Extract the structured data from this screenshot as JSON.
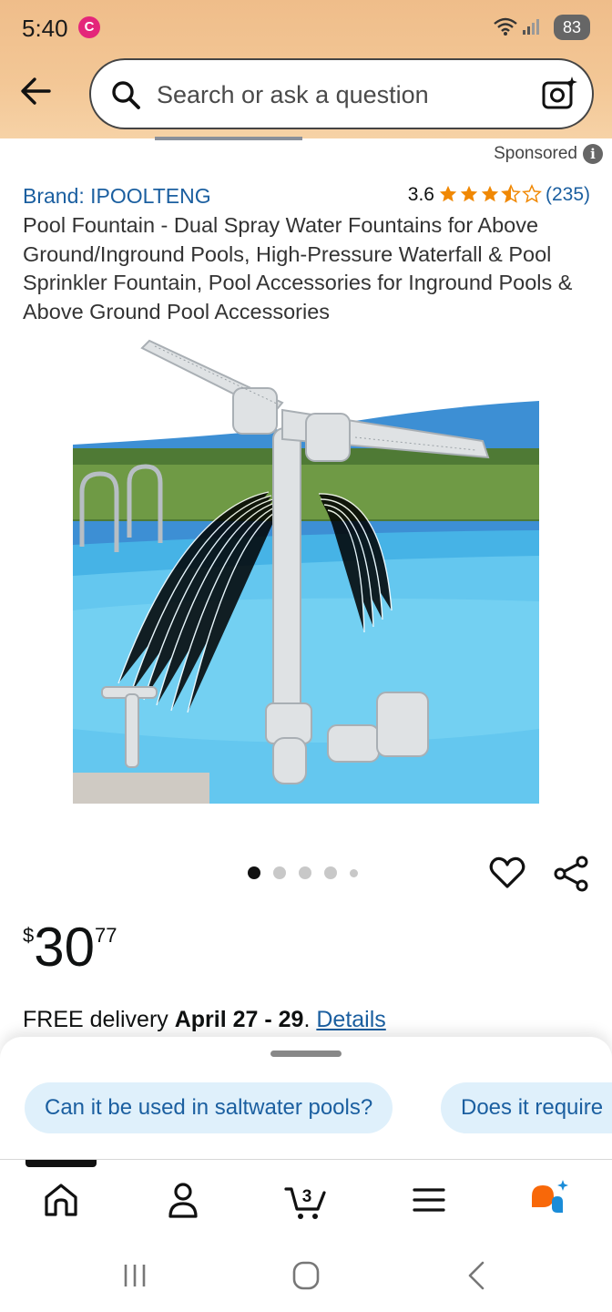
{
  "status_bar": {
    "time": "5:40",
    "notification_badge": "C",
    "battery": "83"
  },
  "search": {
    "placeholder": "Search or ask a question"
  },
  "sponsored": {
    "label": "Sponsored",
    "info_glyph": "i"
  },
  "product": {
    "brand": "Brand: IPOOLTENG",
    "rating": "3.6",
    "rating_value": 3.6,
    "rating_count": "(235)",
    "title": "Pool Fountain - Dual Spray Water Fountains for Above Ground/Inground Pools, High-Pressure Waterfall & Pool Sprinkler Fountain, Pool Accessories for Inground Pools & Above Ground Pool Accessories",
    "image_alt": "Pool fountain product image",
    "carousel": {
      "count": 5,
      "active_index": 0
    },
    "price": {
      "currency": "$",
      "whole": "30",
      "cents": "77"
    },
    "delivery": {
      "prefix": "FREE delivery ",
      "date": "April 27 - 29",
      "suffix": ". ",
      "link": "Details"
    }
  },
  "suggestions": [
    {
      "label": "Can it be used in saltwater pools?"
    },
    {
      "label": "Does it require"
    }
  ],
  "bottom_nav": {
    "items": [
      {
        "icon": "home-icon"
      },
      {
        "icon": "account-icon"
      },
      {
        "icon": "cart-icon",
        "badge": "3"
      },
      {
        "icon": "menu-icon"
      },
      {
        "icon": "rufus-ai-icon"
      }
    ],
    "active_index": 0
  },
  "colors": {
    "header_bg": "#f3c796",
    "link": "#1b5fa0",
    "star": "#f08804",
    "chip_bg": "#dff0fb",
    "badge": "#e4267a"
  }
}
